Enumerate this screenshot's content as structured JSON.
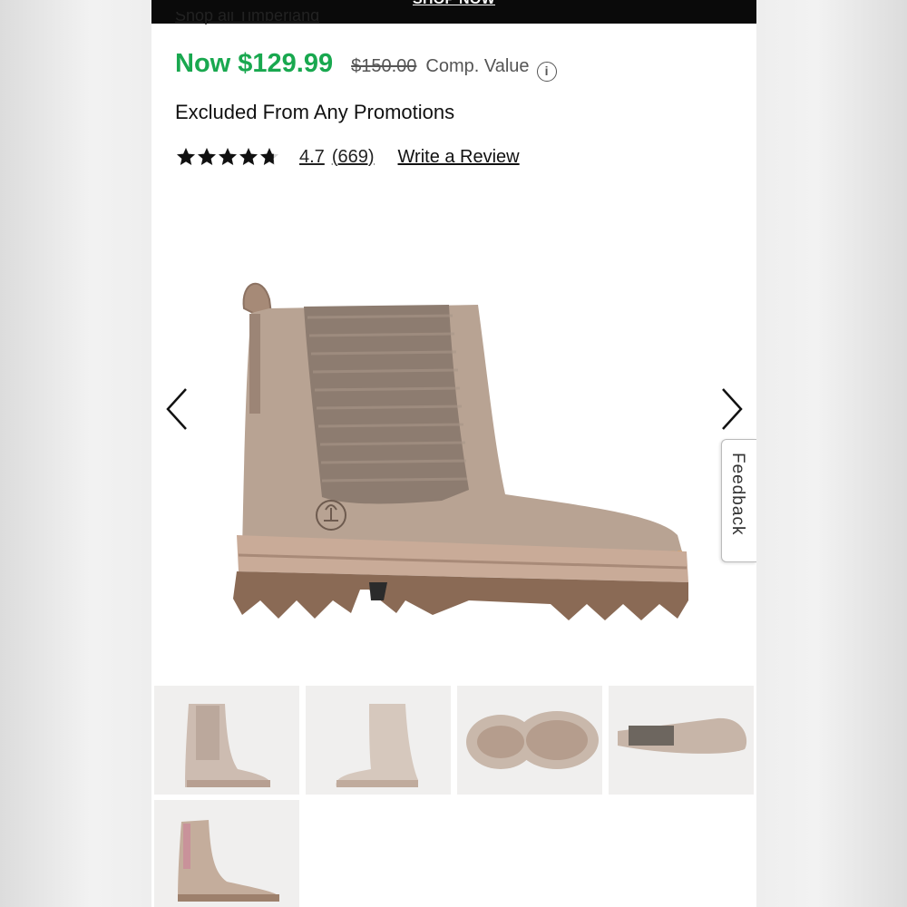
{
  "promo": {
    "text": "SHOP NOW"
  },
  "brand_link": {
    "text": "Shop all Timberland"
  },
  "pricing": {
    "now_price": "Now $129.99",
    "original_price": "$150.00",
    "comp_label": "Comp. Value",
    "info_icon": "info-icon"
  },
  "promotion_note": "Excluded From Any Promotions",
  "rating": {
    "stars": 4.7,
    "value": "4.7",
    "count": "(669)",
    "write_review": "Write a Review"
  },
  "gallery": {
    "prev_icon": "chevron-left-icon",
    "next_icon": "chevron-right-icon",
    "thumbnail_count": 5
  },
  "feedback": {
    "label": "Feedback"
  },
  "colors": {
    "promo_bar": "#0a0a0a",
    "sale_price": "#19a84f",
    "boot_body": "#b9a595",
    "boot_sole": "#8a6a55"
  }
}
